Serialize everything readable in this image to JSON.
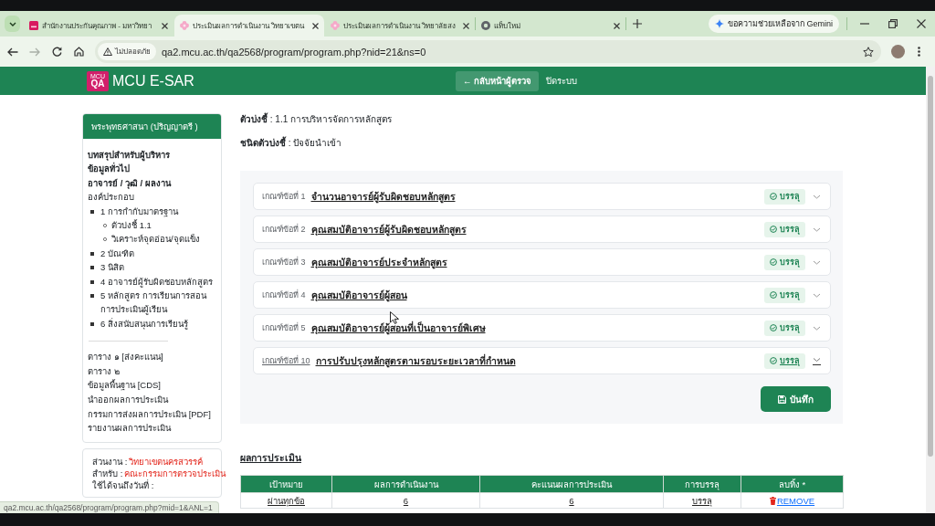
{
  "browser": {
    "tabs": [
      {
        "kind": "logo",
        "title": "สำนักงานประกันคุณภาพ - มหาวิทยา",
        "selected": false
      },
      {
        "kind": "flower",
        "title": "ประเมินผลการดำเนินงาน วิทยาเขตน",
        "selected": true
      },
      {
        "kind": "flower",
        "title": "ประเมินผลการดำเนินงาน วิทยาลัยสง",
        "selected": false
      },
      {
        "kind": "browser",
        "title": "แท็บใหม่",
        "selected": false
      }
    ],
    "assistant_button": "ขอความช่วยเหลือจาก Gemini",
    "address_bar": {
      "security_chip": "ไม่ปลอดภัย",
      "url": "qa2.mcu.ac.th/qa2568/program/program.php?nid=21&ns=0"
    },
    "status_bubble": "qa2.mcu.ac.th/qa2568/program/program.php?mid=1&ANL=1"
  },
  "header": {
    "logo": [
      "MCU",
      "QA"
    ],
    "title": "MCU E-SAR",
    "back_button": "← กลับหน้าผู้ตรวจ",
    "logout_link": "ปิดระบบ"
  },
  "sidebar": {
    "heading": "พระพุทธศาสนา (ปริญญาตรี )",
    "items": [
      {
        "text": "บทสรุปสำหรับผู้บริหาร",
        "bold": true
      },
      {
        "text": "ข้อมูลทั่วไป",
        "bold": true
      },
      {
        "text": "อาจารย์ / วุฒิ / ผลงาน",
        "bold": true
      },
      {
        "text": "องค์ประกอบ",
        "bold": false,
        "children": [
          {
            "text": "1 การกำกับมาตรฐาน",
            "bold": false,
            "children": [
              {
                "text": "ตัวบ่งชี้ 1.1",
                "bold": false
              },
              {
                "text": "วิเคราะห์จุดอ่อน/จุดแข็ง",
                "bold": false
              }
            ]
          },
          {
            "text": "2 บัณฑิต",
            "bold": false
          },
          {
            "text": "3 นิสิต",
            "bold": false
          },
          {
            "text": "4 อาจารย์ผู้รับผิดชอบหลักสูตร",
            "bold": false
          },
          {
            "text": "5 หลักสูตร การเรียนการสอน การประเมินผู้เรียน",
            "bold": false
          },
          {
            "text": "6 สิ่งสนับสนุนการเรียนรู้",
            "bold": false
          }
        ]
      }
    ],
    "links": [
      "ตาราง ๑ [ส่งคะแนน]",
      "ตาราง ๒",
      "ข้อมูลพื้นฐาน [CDS]",
      "นำออกผลการประเมิน",
      "กรรมการส่งผลการประเมิน [PDF]",
      "รายงานผลการประเมิน"
    ],
    "info": [
      {
        "label": "ส่วนงาน :",
        "value": "วิทยาเขตนครสวรรค์"
      },
      {
        "label": "สำหรับ :",
        "value": "คณะกรรมการตรวจประเมิน"
      },
      {
        "label": "ใช้ได้จนถึงวันที่ :"
      }
    ]
  },
  "main": {
    "indicator": "**ตัวบ่งชี้** : 1.1 การบริหารจัดการหลักสูตร",
    "indicator_type": "**ชนิดตัวบ่งชี้** : ปัจจัยนำเข้า",
    "criteria": [
      {
        "number": "เกณฑ์ข้อที่ 1",
        "title": "จำนวนอาจารย์ผู้รับผิดชอบหลักสูตร",
        "status": "บรรลุ",
        "underlined": false
      },
      {
        "number": "เกณฑ์ข้อที่ 2",
        "title": "คุณสมบัติอาจารย์ผู้รับผิดชอบหลักสูตร",
        "status": "บรรลุ",
        "underlined": false
      },
      {
        "number": "เกณฑ์ข้อที่ 3",
        "title": "คุณสมบัติอาจารย์ประจำหลักสูตร",
        "status": "บรรลุ",
        "underlined": false
      },
      {
        "number": "เกณฑ์ข้อที่ 4",
        "title": "คุณสมบัติอาจารย์ผู้สอน",
        "status": "บรรลุ",
        "underlined": false
      },
      {
        "number": "เกณฑ์ข้อที่ 5",
        "title": "คุณสมบัติอาจารย์ผู้สอนที่เป็นอาจารย์พิเศษ",
        "status": "บรรลุ",
        "underlined": false
      },
      {
        "number": "เกณฑ์ข้อที่ 10",
        "title": "การปรับปรุงหลักสูตรตามรอบระยะเวลาที่กำหนด",
        "status": "บรรลุ",
        "underlined": true
      }
    ],
    "save_button": "บันทึก",
    "results": {
      "heading": "ผลการประเมิน",
      "columns": [
        "เป้าหมาย",
        "ผลการดำเนินงาน",
        "คะแนนผลการประเมิน",
        "การบรรลุ",
        "ลบทิ้ง *"
      ],
      "rows": [
        {
          "cells": [
            "ผ่านทุกข้อ",
            "6",
            "6",
            "บรรลุ"
          ],
          "action": "REMOVE"
        }
      ]
    }
  }
}
